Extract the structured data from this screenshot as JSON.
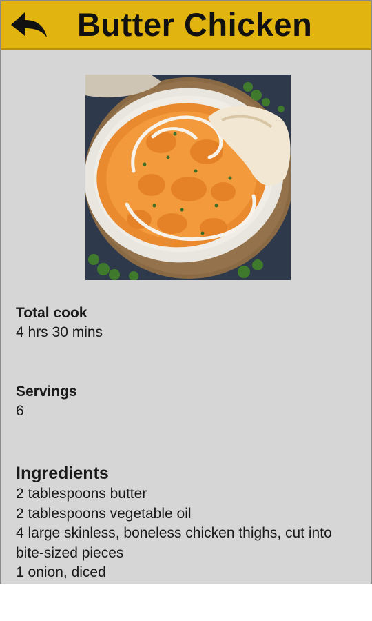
{
  "header": {
    "title": "Butter Chicken",
    "back_icon": "back-arrow-icon",
    "background": "#e2b40f"
  },
  "image": {
    "alt": "Butter Chicken"
  },
  "total_cook": {
    "label": "Total cook",
    "value": "4 hrs 30 mins"
  },
  "servings": {
    "label": "Servings",
    "value": "6"
  },
  "ingredients": {
    "title": "Ingredients",
    "items": [
      "2 tablespoons butter",
      "2 tablespoons vegetable oil",
      "4 large skinless, boneless chicken thighs, cut into bite-sized pieces",
      "1 onion, diced"
    ]
  }
}
